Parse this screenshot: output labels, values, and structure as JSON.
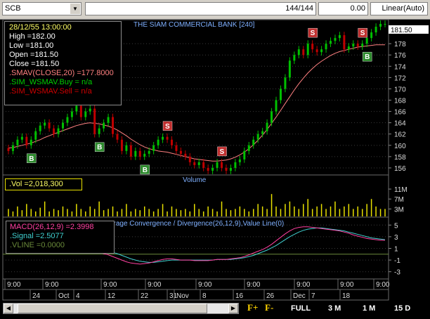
{
  "toolbar": {
    "symbol": "SCB",
    "count": "144/144",
    "value": "0.00",
    "scale_mode": "Linear(Auto)"
  },
  "price_panel": {
    "title": "THE SIAM COMMERCIAL BANK [240]",
    "current_price": "181.50",
    "info": {
      "datetime": "28/12/55 13:00:00",
      "high": "High =182.00",
      "low": "Low =181.00",
      "open": "Open =181.50",
      "close": "Close =181.50",
      "smav": ".SMAV(CLOSE,20) =177.8000",
      "buy": ".SIM_WSMAV.Buy = n/a",
      "sell": ".SIM_WSMAV.Sell = n/a"
    },
    "y_ticks": [
      "178",
      "176",
      "174",
      "172",
      "170",
      "168",
      "166",
      "164",
      "162",
      "160",
      "158",
      "156"
    ],
    "signals": [
      {
        "label": "B",
        "type": "buy",
        "i": 5
      },
      {
        "label": "B",
        "type": "buy",
        "i": 20
      },
      {
        "label": "B",
        "type": "buy",
        "i": 30
      },
      {
        "label": "S",
        "type": "sell",
        "i": 35
      },
      {
        "label": "S",
        "type": "sell",
        "i": 47
      },
      {
        "label": "S",
        "type": "sell",
        "i": 67
      },
      {
        "label": "S",
        "type": "sell",
        "i": 78
      },
      {
        "label": "B",
        "type": "buy",
        "i": 79
      }
    ]
  },
  "volume_panel": {
    "title": "Volume",
    "info": ".Vol =2,018,300",
    "y_ticks": [
      "11M",
      "7M",
      "3M"
    ]
  },
  "macd_panel": {
    "title": "Moving Average Convergence / Divergence(26,12,9),Value Line(0)",
    "macd": "MACD(26,12,9) =2.3998",
    "signal": ".Signal =2.5077",
    "vline": ".VLINE =0.0000",
    "y_ticks": [
      "5",
      "3",
      "1",
      "-1",
      "-3"
    ]
  },
  "time_axis": {
    "top_labels": [
      "9:00",
      "9:00",
      "9:00",
      "9:00",
      "9:00",
      "9:00",
      "9:00",
      "9:00",
      "9:00",
      "9:00"
    ],
    "bottom_labels": [
      "24",
      "Oct",
      "4",
      "12",
      "22",
      "31",
      "Nov",
      "8",
      "16",
      "26",
      "Dec",
      "7",
      "18"
    ]
  },
  "bottom_bar": {
    "f_plus": "F+",
    "f_minus": "F-",
    "full": "FULL",
    "m3": "3 M",
    "m1": "1 M",
    "d15": "15 D"
  },
  "colors": {
    "up": "#00c000",
    "down": "#c00000",
    "ma": "#ff8080",
    "macd": "#ff40a0",
    "signal": "#40d0d0",
    "volume": "#e8e000",
    "buy_marker": "#2e8b2e",
    "sell_marker": "#c03030"
  },
  "chart_data": {
    "type": "candlestick",
    "price": {
      "ylim": [
        155,
        182
      ],
      "opens": [
        159.5,
        159,
        160,
        161,
        161.5,
        160,
        161,
        162.5,
        163.5,
        164,
        163,
        162,
        163,
        164,
        165,
        166,
        167,
        165,
        166,
        166.5,
        162,
        163,
        164,
        165,
        162,
        161,
        159,
        160,
        158,
        159,
        158,
        158.5,
        159,
        160,
        161,
        161.5,
        161,
        160,
        159,
        158.5,
        158,
        157,
        156.5,
        157,
        156,
        155.5,
        156,
        157,
        156,
        155.5,
        156,
        157,
        157.5,
        159,
        160,
        161,
        162,
        162.5,
        164,
        166,
        168,
        170,
        172,
        175,
        176,
        177,
        176,
        178,
        177,
        176.5,
        177,
        178,
        178.5,
        179,
        179.5,
        177,
        177.5,
        178,
        177.5,
        178,
        179,
        180,
        181,
        181.5
      ],
      "closes": [
        159,
        160,
        161,
        161.5,
        160,
        161,
        162.5,
        163.5,
        164,
        163,
        162,
        163,
        164,
        165,
        166,
        167,
        165,
        166,
        166.5,
        162,
        163,
        164,
        165,
        162,
        161,
        159,
        160,
        158,
        159,
        158,
        158.5,
        159,
        160,
        161,
        161.5,
        161,
        160,
        159,
        158.5,
        158,
        157,
        156.5,
        157,
        156,
        155.5,
        156,
        157,
        156,
        155.5,
        156,
        157,
        157.5,
        159,
        160,
        161,
        162,
        162.5,
        164,
        166,
        168,
        170,
        172,
        175,
        176,
        177,
        176,
        178,
        177,
        176.5,
        177,
        178,
        178.5,
        179,
        179.5,
        177,
        177.5,
        178,
        177.5,
        178,
        179,
        180,
        181,
        181.5,
        181.5
      ],
      "ma": [
        159.5,
        159.6,
        159.8,
        160,
        160.2,
        160.4,
        160.7,
        161,
        161.4,
        161.7,
        162,
        162.3,
        162.6,
        162.9,
        163.2,
        163.5,
        163.7,
        163.9,
        164,
        163.9,
        163.8,
        163.6,
        163.4,
        163.1,
        162.7,
        162.2,
        161.7,
        161.1,
        160.6,
        160.1,
        159.7,
        159.4,
        159.2,
        159,
        158.9,
        158.8,
        158.6,
        158.4,
        158.2,
        158,
        157.8,
        157.6,
        157.5,
        157.4,
        157.3,
        157.2,
        157.2,
        157.3,
        157.4,
        157.6,
        157.9,
        158.3,
        158.8,
        159.4,
        160.1,
        160.9,
        161.8,
        162.8,
        163.9,
        165,
        166.2,
        167.4,
        168.6,
        169.8,
        170.9,
        171.9,
        172.8,
        173.6,
        174.3,
        174.9,
        175.4,
        175.9,
        176.3,
        176.6,
        176.8,
        177,
        177.2,
        177.4,
        177.5,
        177.6,
        177.7,
        177.8,
        177.8,
        177.8
      ]
    },
    "volume": {
      "ylim": [
        0,
        13
      ],
      "values": [
        3,
        2,
        4,
        2.5,
        5,
        3,
        2,
        3.5,
        6,
        2,
        3,
        2.5,
        4,
        3,
        2,
        5,
        3,
        2,
        4,
        3,
        6,
        2.5,
        3,
        4,
        2,
        3,
        5,
        2,
        3,
        2.5,
        4,
        3,
        2,
        3,
        5,
        2,
        4,
        3,
        2.5,
        3,
        2,
        5,
        3,
        2,
        4,
        3,
        2,
        6,
        3,
        2.5,
        3,
        4,
        3,
        2,
        3,
        5,
        4,
        3,
        9,
        4,
        3,
        5,
        6,
        4,
        3,
        5,
        7,
        3,
        4,
        5,
        3,
        4,
        6,
        3,
        4,
        5,
        3,
        4,
        3,
        5,
        7,
        4,
        3,
        3
      ]
    },
    "macd": {
      "ylim": [
        -4,
        6
      ],
      "macd": [
        0.8,
        0.7,
        0.6,
        0.5,
        0.4,
        0.3,
        0.4,
        0.6,
        0.8,
        1.0,
        1.1,
        1.2,
        1.3,
        1.4,
        1.5,
        1.6,
        1.4,
        1.2,
        1.0,
        0.6,
        0.3,
        0.1,
        -0.1,
        -0.4,
        -0.7,
        -1.0,
        -1.3,
        -1.5,
        -1.6,
        -1.7,
        -1.6,
        -1.5,
        -1.3,
        -1.1,
        -0.9,
        -0.8,
        -0.8,
        -0.9,
        -1.0,
        -1.0,
        -1.0,
        -1.1,
        -1.1,
        -1.1,
        -1.1,
        -1.0,
        -0.9,
        -0.9,
        -0.9,
        -0.8,
        -0.7,
        -0.6,
        -0.4,
        -0.1,
        0.2,
        0.5,
        0.8,
        1.2,
        1.7,
        2.3,
        2.9,
        3.5,
        4.0,
        4.4,
        4.6,
        4.7,
        4.7,
        4.6,
        4.5,
        4.4,
        4.3,
        4.2,
        4.1,
        4.0,
        3.8,
        3.6,
        3.3,
        3.1,
        2.9,
        2.7,
        2.6,
        2.5,
        2.4,
        2.4
      ],
      "signal": [
        1.0,
        0.9,
        0.8,
        0.7,
        0.6,
        0.5,
        0.5,
        0.5,
        0.6,
        0.7,
        0.8,
        0.9,
        1.0,
        1.1,
        1.2,
        1.3,
        1.3,
        1.3,
        1.2,
        1.1,
        0.9,
        0.7,
        0.5,
        0.3,
        0.1,
        -0.2,
        -0.5,
        -0.8,
        -1.0,
        -1.2,
        -1.3,
        -1.4,
        -1.4,
        -1.3,
        -1.2,
        -1.1,
        -1.0,
        -1.0,
        -1.0,
        -1.0,
        -1.0,
        -1.0,
        -1.0,
        -1.0,
        -1.0,
        -1.0,
        -0.9,
        -0.9,
        -0.9,
        -0.9,
        -0.8,
        -0.7,
        -0.6,
        -0.4,
        -0.2,
        0.1,
        0.4,
        0.7,
        1.1,
        1.5,
        2.0,
        2.5,
        3.0,
        3.4,
        3.8,
        4.1,
        4.3,
        4.4,
        4.5,
        4.5,
        4.4,
        4.3,
        4.2,
        4.1,
        4.0,
        3.8,
        3.6,
        3.4,
        3.2,
        3.0,
        2.8,
        2.7,
        2.6,
        2.5
      ]
    }
  }
}
